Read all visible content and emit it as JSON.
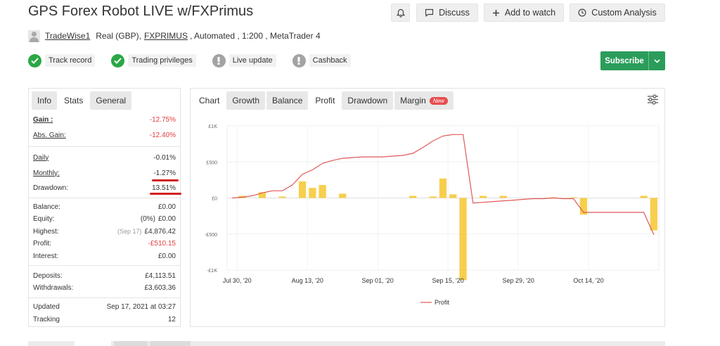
{
  "header": {
    "title": "GPS Forex Robot LIVE w/FXPrimus",
    "buttons": {
      "discuss": "Discuss",
      "watch": "Add to watch",
      "analysis": "Custom Analysis"
    }
  },
  "subline": {
    "user": "TradeWise1",
    "account": "Real (GBP),",
    "broker": "FXPRIMUS",
    "details": ", Automated , 1:200 , MetaTrader 4"
  },
  "badges": [
    {
      "label": "Track record",
      "status": "ok"
    },
    {
      "label": "Trading privileges",
      "status": "ok"
    },
    {
      "label": "Live update",
      "status": "na"
    },
    {
      "label": "Cashback",
      "status": "na"
    }
  ],
  "subscribe": {
    "label": "Subscribe"
  },
  "info": {
    "tabs": [
      "Info",
      "Stats",
      "General"
    ],
    "rows": {
      "gain": {
        "label": "Gain :",
        "value": "-12.75%"
      },
      "abs_gain": {
        "label": "Abs. Gain:",
        "value": "-12.40%"
      },
      "daily": {
        "label": "Daily",
        "value": "-0.01%"
      },
      "monthly": {
        "label": "Monthly:",
        "value": "-1.27%"
      },
      "drawdown": {
        "label": "Drawdown:",
        "value": "13.51%"
      },
      "balance": {
        "label": "Balance:",
        "value": "£0.00"
      },
      "equity": {
        "label": "Equity:",
        "note": "(0%)",
        "value": "£0.00"
      },
      "highest": {
        "label": "Highest:",
        "note": "(Sep 17)",
        "value": "£4,876.42"
      },
      "profit": {
        "label": "Profit:",
        "value": "-£510.15"
      },
      "interest": {
        "label": "Interest:",
        "value": "£0.00"
      },
      "deposits": {
        "label": "Deposits:",
        "value": "£4,113.51"
      },
      "withdrawals": {
        "label": "Withdrawals:",
        "value": "£3,603.36"
      },
      "updated": {
        "label": "Updated",
        "value": "Sep 17, 2021 at 03:27"
      },
      "tracking": {
        "label": "Tracking",
        "value": "12"
      }
    }
  },
  "chart_tabs": [
    "Chart",
    "Growth",
    "Balance",
    "Profit",
    "Drawdown",
    "Margin"
  ],
  "chart_new_tag": "New",
  "colors": {
    "bar": "#f7cf4d",
    "line": "#e05858",
    "positive": "#2aa745",
    "negative": "#e23d3d",
    "subscribe": "#2a9d5a"
  },
  "chart_data": {
    "type": "bar",
    "y_ticks": [
      "£1K",
      "£500",
      "£0",
      "-£500",
      "-£1K"
    ],
    "ylim": [
      -1000,
      1000
    ],
    "x_ticks": [
      "Jul 30, '20",
      "Aug 13, '20",
      "Sep 01, '20",
      "Sep 15, '20",
      "Sep 29, '20",
      "Oct 14, '20"
    ],
    "x_tick_index": [
      0,
      7,
      14,
      21,
      28,
      35
    ],
    "categories": [
      "Jul 30",
      "Jul 31",
      "Aug 03",
      "Aug 04",
      "Aug 05",
      "Aug 06",
      "Aug 07",
      "Aug 13",
      "Aug 14",
      "Aug 17",
      "Aug 18",
      "Aug 19",
      "Aug 20",
      "Aug 21",
      "Sep 01",
      "Sep 02",
      "Sep 03",
      "Sep 04",
      "Sep 07",
      "Sep 08",
      "Sep 09",
      "Sep 15",
      "Sep 16",
      "Sep 17",
      "Sep 18",
      "Sep 21",
      "Sep 22",
      "Sep 23",
      "Sep 29",
      "Sep 30",
      "Oct 01",
      "Oct 02",
      "Oct 05",
      "Oct 06",
      "Oct 07",
      "Oct 14",
      "Oct 15",
      "Oct 16",
      "Oct 19",
      "Oct 20",
      "Oct 21",
      "Oct 22",
      "Oct 23"
    ],
    "series": [
      {
        "name": "Profit",
        "type": "bar",
        "values": [
          0,
          30,
          0,
          80,
          0,
          20,
          0,
          230,
          140,
          180,
          0,
          60,
          0,
          0,
          0,
          0,
          0,
          0,
          30,
          0,
          20,
          270,
          50,
          -1140,
          0,
          30,
          0,
          30,
          0,
          0,
          0,
          0,
          10,
          0,
          10,
          -230,
          0,
          0,
          0,
          0,
          0,
          30,
          -450
        ]
      },
      {
        "name": "Profit",
        "type": "line",
        "values": [
          0,
          10,
          30,
          70,
          100,
          100,
          180,
          330,
          390,
          480,
          520,
          550,
          560,
          570,
          570,
          570,
          580,
          590,
          620,
          700,
          790,
          860,
          880,
          880,
          -70,
          -60,
          -50,
          -40,
          -30,
          -20,
          -10,
          -10,
          0,
          -10,
          -10,
          -200,
          -200,
          -200,
          -200,
          -200,
          -200,
          -200,
          -510
        ]
      }
    ],
    "legend": [
      "Profit"
    ],
    "legend_position": "bottom-center"
  }
}
